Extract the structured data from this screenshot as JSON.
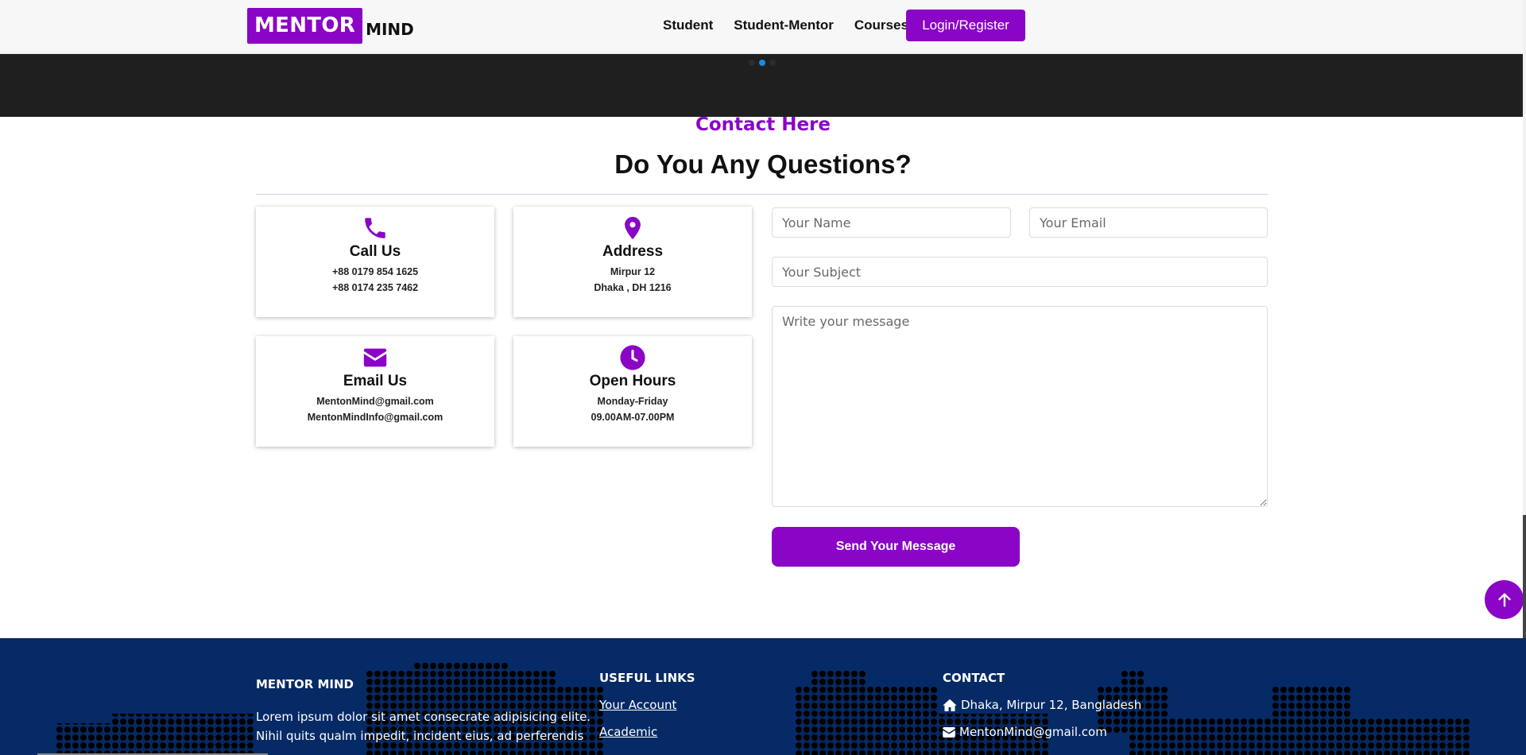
{
  "brand": {
    "highlight": "MENTOR",
    "rest": "MIND"
  },
  "nav": {
    "links": [
      "Student",
      "Student-Mentor",
      "Courses"
    ],
    "login_label": "Login/Register"
  },
  "contact": {
    "subtitle": "Contact Here",
    "title": "Do You Any Questions?",
    "cards": [
      {
        "icon": "phone-icon",
        "title": "Call Us",
        "lines": [
          "+88 0179 854 1625",
          "+88 0174 235 7462"
        ]
      },
      {
        "icon": "map-pin-icon",
        "title": "Address",
        "lines": [
          "Mirpur 12",
          "Dhaka , DH 1216"
        ]
      },
      {
        "icon": "envelope-icon",
        "title": "Email Us",
        "lines": [
          "MentonMind@gmail.com",
          "MentonMindInfo@gmail.com"
        ]
      },
      {
        "icon": "clock-icon",
        "title": "Open Hours",
        "lines": [
          "Monday-Friday",
          "09.00AM-07.00PM"
        ]
      }
    ]
  },
  "form": {
    "name_placeholder": "Your Name",
    "email_placeholder": "Your Email",
    "subject_placeholder": "Your Subject",
    "message_placeholder": "Write your message",
    "send_label": "Send Your Message"
  },
  "footer": {
    "about": {
      "heading": "MENTOR MIND",
      "text_line1": "Lorem ipsum dolor sit amet consecrate adipisicing elite.",
      "text_line2": "Nihil quits qualm impedit, incident eius, ad perferendis"
    },
    "links": {
      "heading": "USEFUL LINKS",
      "items": [
        "Your Account",
        "Academic"
      ]
    },
    "contact": {
      "heading": "CONTACT",
      "address": "Dhaka, Mirpur 12, Bangladesh",
      "email": "MentonMind@gmail.com"
    }
  },
  "colors": {
    "accent": "#8a05c6",
    "footer_bg": "#062a65",
    "hero_bg": "#1f1f1f"
  }
}
